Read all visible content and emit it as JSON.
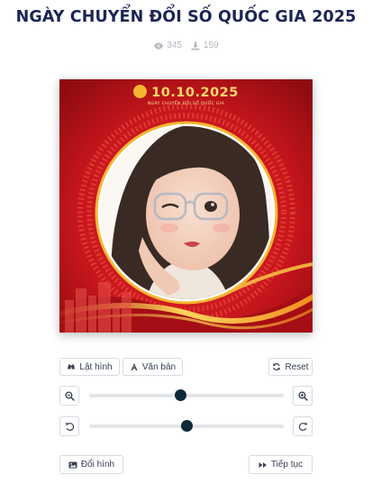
{
  "page": {
    "title": "NGÀY CHUYỂN ĐỔI SỐ QUỐC GIA 2025",
    "views": "345",
    "downloads": "159"
  },
  "frame": {
    "logo_text": "10.10.2025",
    "logo_subtext": "NGÀY CHUYỂN ĐỔI SỐ QUỐC GIA",
    "colors": {
      "primary_red": "#c8161d",
      "gold": "#f4b531",
      "dark_red": "#8e0c10"
    }
  },
  "toolbar": {
    "flip_label": "Lật hình",
    "text_label": "Văn bản",
    "reset_label": "Reset"
  },
  "controls": {
    "zoom_level": 0.47,
    "rotate_level": 0.5,
    "icons": [
      "zoom-out-icon",
      "zoom-in-icon",
      "rotate-left-icon",
      "rotate-right-icon"
    ]
  },
  "footer": {
    "change_image_label": "Đổi hình",
    "continue_label": "Tiếp tục"
  }
}
